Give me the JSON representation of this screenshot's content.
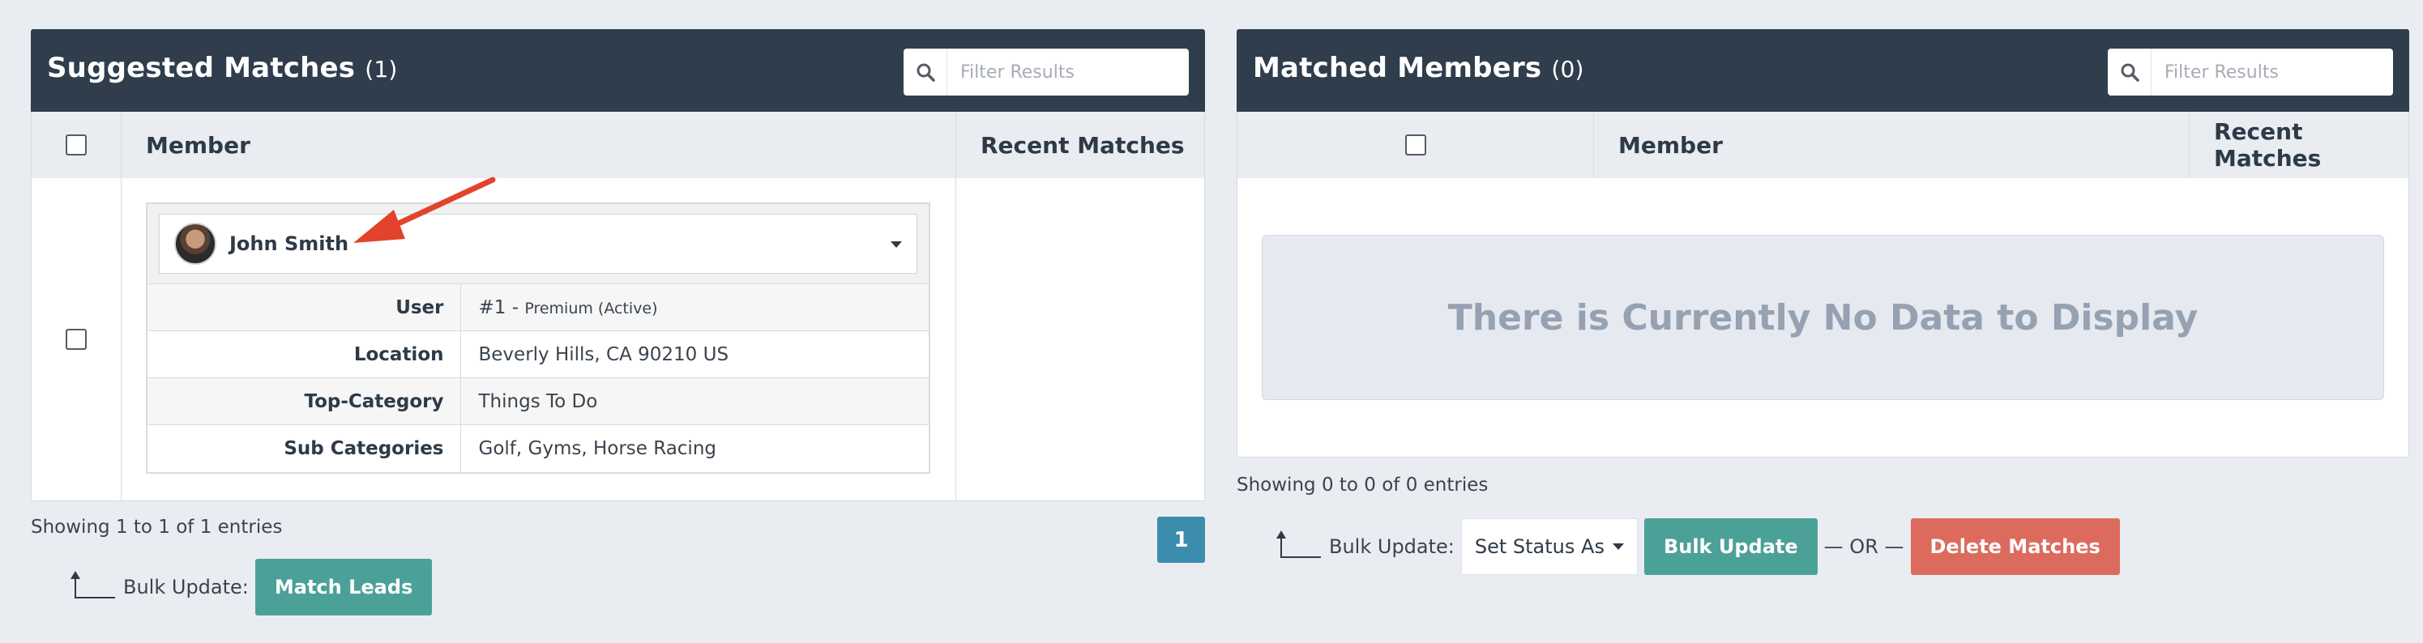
{
  "left_panel": {
    "title": "Suggested Matches",
    "count": "(1)",
    "filter_placeholder": "Filter Results",
    "columns": {
      "member": "Member",
      "recent": "Recent Matches"
    },
    "member": {
      "name": "John Smith",
      "rows": [
        {
          "label": "User",
          "value_main": "#1 - ",
          "value_small": "Premium (Active)"
        },
        {
          "label": "Location",
          "value_main": "Beverly Hills, CA 90210 US",
          "value_small": ""
        },
        {
          "label": "Top-Category",
          "value_main": "Things To Do",
          "value_small": ""
        },
        {
          "label": "Sub Categories",
          "value_main": "Golf, Gyms, Horse Racing",
          "value_small": ""
        }
      ]
    },
    "entries_text": "Showing 1 to 1 of 1 entries",
    "bulk_label": "Bulk Update:",
    "match_leads_label": "Match Leads",
    "page_number": "1"
  },
  "right_panel": {
    "title": "Matched Members",
    "count": "(0)",
    "filter_placeholder": "Filter Results",
    "columns": {
      "member": "Member",
      "recent": "Recent Matches"
    },
    "empty_message": "There is Currently No Data to Display",
    "entries_text": "Showing 0 to 0 of 0 entries",
    "bulk_label": "Bulk Update:",
    "set_status_label": "Set Status As",
    "bulk_update_label": "Bulk Update",
    "or_text": "— OR —",
    "delete_label": "Delete Matches"
  },
  "colors": {
    "header_bg": "#2f3d4c",
    "teal_button": "#4ba197",
    "red_button": "#dc6b5e",
    "page_button": "#3b8cad",
    "annotation_arrow": "#e2432d"
  },
  "icons": [
    "search-icon",
    "chevron-down-icon",
    "checkbox-icon",
    "corner-arrow-icon",
    "annotation-arrow-icon"
  ]
}
